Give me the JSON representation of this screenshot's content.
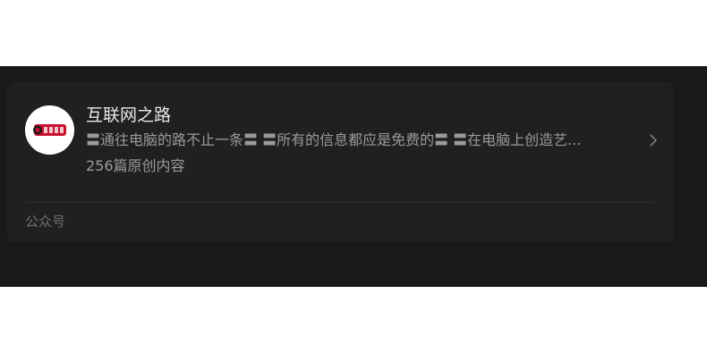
{
  "account": {
    "name": "互联网之路",
    "description": "〓通往电脑的路不止一条〓 〓所有的信息都应是免费的〓 〓在电脑上创造艺...",
    "article_count": "256篇原创内容",
    "avatar_icon": "logo-avatar-icon",
    "chevron_icon": "chevron-right-icon"
  },
  "footer": {
    "type_label": "公众号"
  },
  "colors": {
    "page_bg": "#191919",
    "card_bg": "#202020",
    "title": "#e8e8e8",
    "secondary": "#9a9a9a",
    "muted": "#6f6f6f",
    "logo_red": "#c8102e"
  }
}
